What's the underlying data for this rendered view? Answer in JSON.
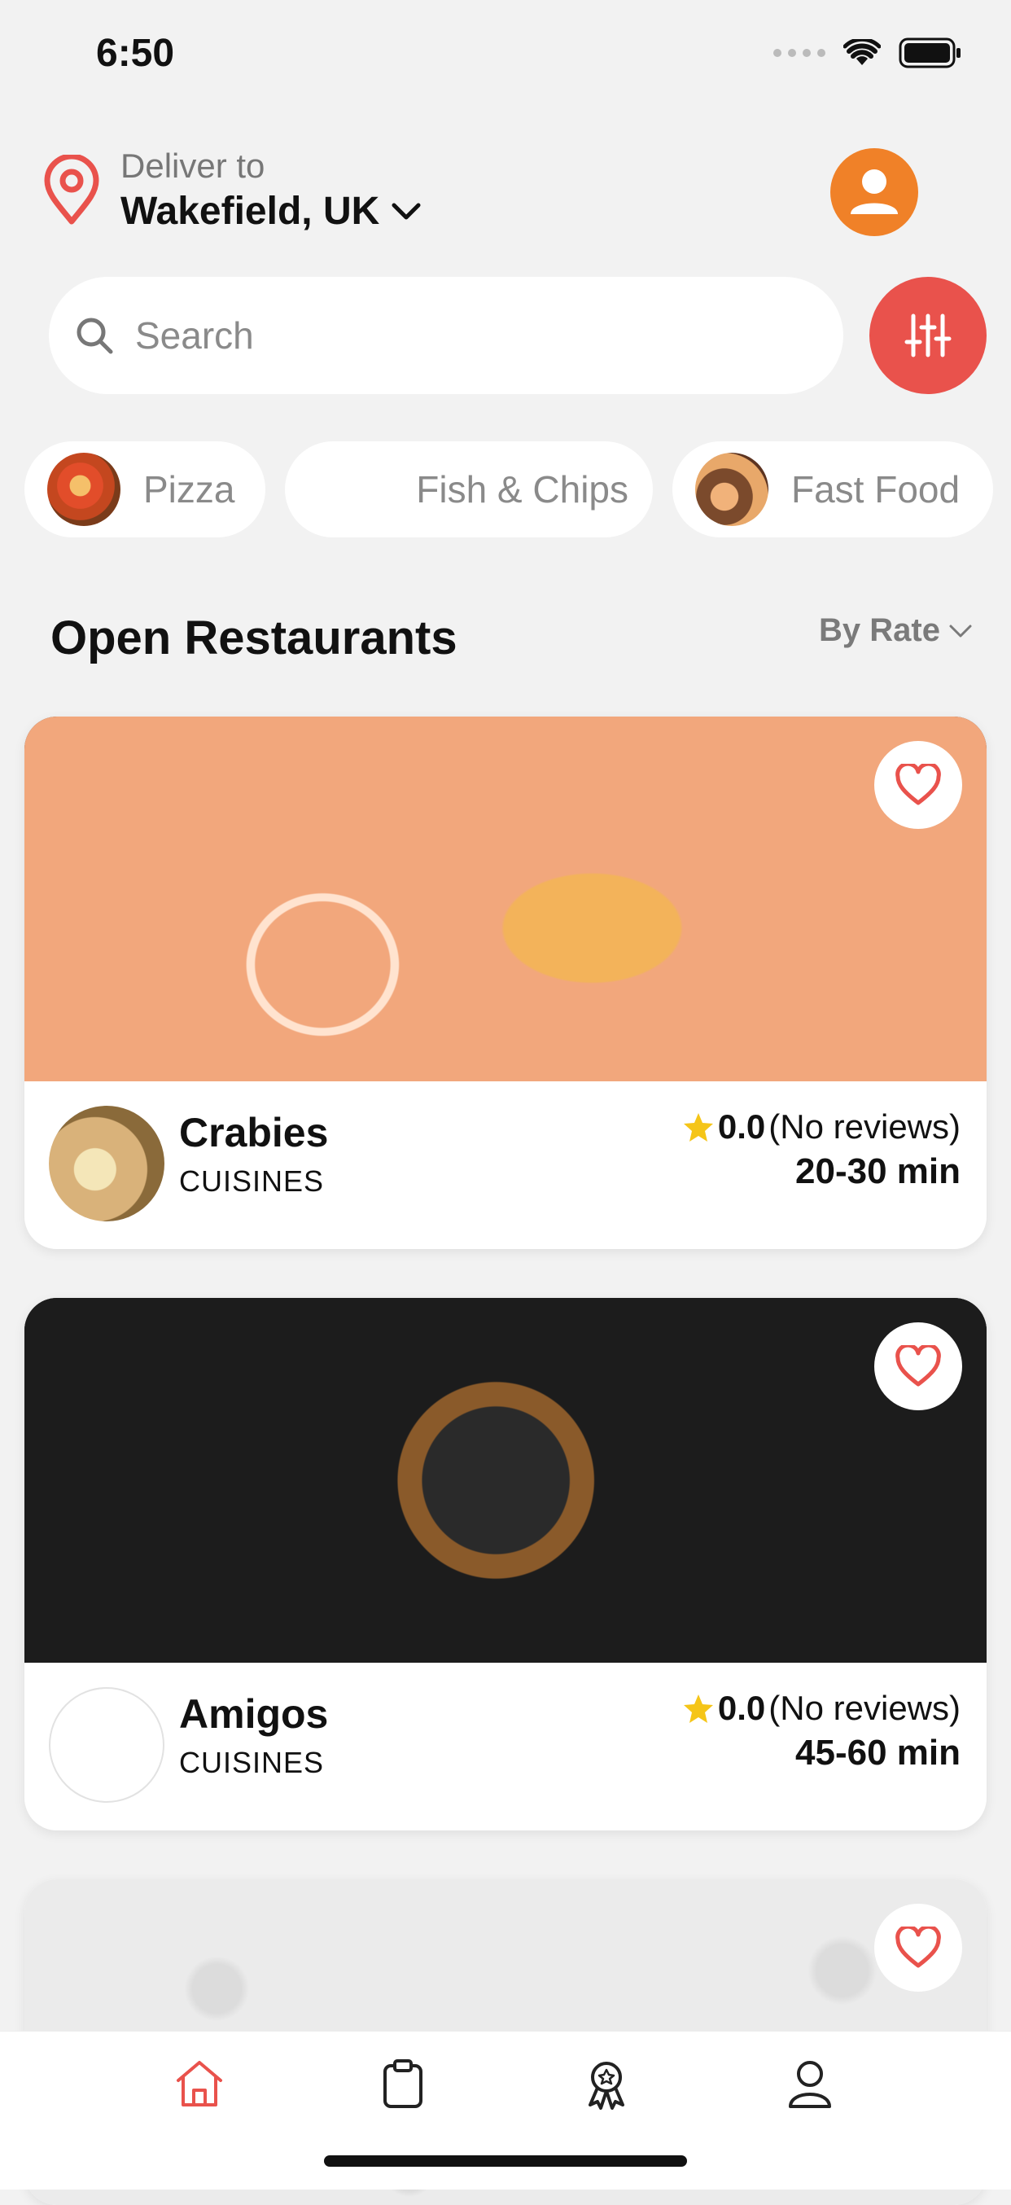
{
  "status_bar": {
    "time": "6:50"
  },
  "location": {
    "label": "Deliver to",
    "value": "Wakefield, UK"
  },
  "search": {
    "placeholder": "Search"
  },
  "categories": [
    {
      "label": "Pizza"
    },
    {
      "label": "Fish & Chips"
    },
    {
      "label": "Fast Food"
    }
  ],
  "section": {
    "title": "Open Restaurants",
    "sort_label": "By Rate"
  },
  "restaurants": [
    {
      "name": "Crabies",
      "cuisine_label": "CUISINES",
      "rating": "0.0",
      "reviews": "(No reviews)",
      "delivery_time": "20-30 min"
    },
    {
      "name": "Amigos",
      "cuisine_label": "CUISINES",
      "rating": "0.0",
      "reviews": "(No reviews)",
      "delivery_time": "45-60 min"
    }
  ],
  "colors": {
    "accent": "#e9524c",
    "avatar": "#f08128",
    "star": "#f5c518",
    "tab_active": "#e9524c",
    "tab_inactive": "#222222"
  },
  "tabbar": {
    "items": [
      {
        "icon": "home-icon",
        "active": true
      },
      {
        "icon": "orders-icon",
        "active": false
      },
      {
        "icon": "rewards-icon",
        "active": false
      },
      {
        "icon": "profile-icon",
        "active": false
      }
    ]
  }
}
